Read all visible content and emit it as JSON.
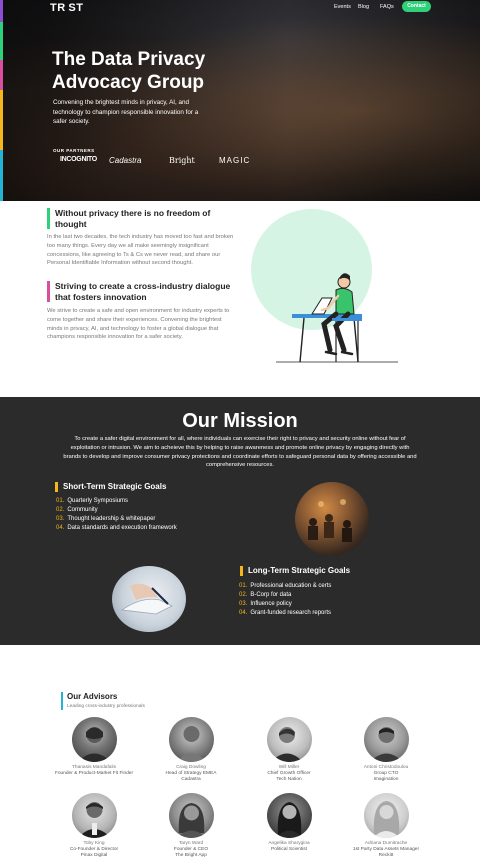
{
  "header": {
    "logo_text": "TR ST",
    "nav": [
      "Events",
      "Blog",
      "FAQs"
    ],
    "contact_label": "Contact"
  },
  "hero": {
    "title": "The Data Privacy Advocacy Group",
    "subtitle": "Convening the brightest minds in privacy, AI, and technology to champion responsible innovation for a safer society.",
    "partners_label": "OUR PARTNERS",
    "partners": [
      "INCOGNITO",
      "Cadastra",
      "Bright",
      "MAGIC"
    ]
  },
  "privacy": {
    "heading1": "Without privacy there is no freedom of thought",
    "para1": "In the last two decades, the tech industry has moved too fast and broken too many things. Every day we all make seemingly insignificant concessions, like agreeing to Ts & Cs we never read, and share our Personal Identifiable Information without second thought.",
    "heading2": "Striving to create a cross-industry dialogue that fosters innovation",
    "para2": "We strive to create a safe and open environment for industry experts to come together and share their experiences. Convening the brightest minds in privacy, AI, and technology to foster a global dialogue that champions responsible innovation for a safer society."
  },
  "mission": {
    "title": "Our Mission",
    "text": "To create a safer digital environment for all, where individuals can exercise their right to privacy and security online without fear of exploitation or intrusion. We aim to acheieve this by helping to raise awareness and promote online privacy by engaging directly with brands to develop and improve consumer privacy protections and coordinate efforts to safeguard personal data by offering accessible and comprehensive resources.",
    "short_term": {
      "heading": "Short-Term Strategic Goals",
      "items": [
        {
          "num": "01.",
          "text": "Quarterly Symposiums"
        },
        {
          "num": "02.",
          "text": "Community"
        },
        {
          "num": "03.",
          "text": "Thought leadership & whitepaper"
        },
        {
          "num": "04.",
          "text": "Data standards and execution framework"
        }
      ]
    },
    "long_term": {
      "heading": "Long-Term Strategic Goals",
      "items": [
        {
          "num": "01.",
          "text": "Professional education & certs"
        },
        {
          "num": "02.",
          "text": "B-Corp for data"
        },
        {
          "num": "03.",
          "text": "Influence policy"
        },
        {
          "num": "04.",
          "text": "Grant-funded research reports"
        }
      ]
    }
  },
  "advisors": {
    "heading": "Our Advisors",
    "subheading": "Leading cross-industry professionals",
    "people": [
      {
        "name": "Thanasis Mandafalis",
        "role": "Founder & Product-Market Fit Finder",
        "org": ""
      },
      {
        "name": "Craig Dowling",
        "role": "Head of Strategy EMEA",
        "org": "Cadastra"
      },
      {
        "name": "Will Miller",
        "role": "Chief Growth Officer",
        "org": "Tech Nation"
      },
      {
        "name": "Antoni Christodoulou",
        "role": "Group CTO",
        "org": "Imagination"
      },
      {
        "name": "Toby King",
        "role": "Co-Founder & Director",
        "org": "Pinax Digital"
      },
      {
        "name": "Taryn Ward",
        "role": "Founder & CEO",
        "org": "The Bright App"
      },
      {
        "name": "Angelika Sharygina",
        "role": "Political Scientist",
        "org": ""
      },
      {
        "name": "Adriana Dumitrache",
        "role": "1st Party Data Assets Manager",
        "org": "Reckitt"
      }
    ]
  },
  "colors": {
    "accent_green": "#2fd07a",
    "accent_yellow": "#f3b71c",
    "accent_pink": "#d84fa0",
    "accent_blue": "#23b3d4",
    "mission_bg": "#2b2b2b"
  }
}
